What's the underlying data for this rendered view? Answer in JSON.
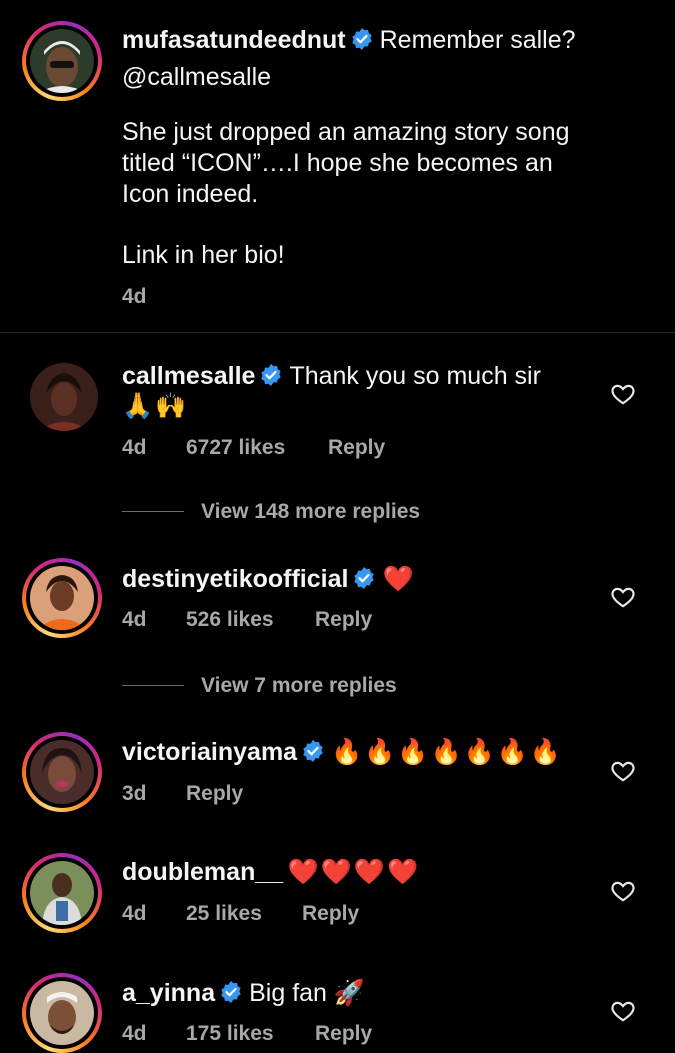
{
  "post": {
    "username": "mufasatundeednut",
    "lines": [
      "Remember salle?",
      "@callmesalle",
      "She just dropped an amazing story song",
      "titled “ICON”….I hope she becomes an",
      "Icon indeed.",
      "Link in her bio!"
    ],
    "time": "4d"
  },
  "comments": [
    {
      "username": "callmesalle",
      "text": "Thank you so much sir",
      "emoji_line": "🙏🙌",
      "time": "4d",
      "likes": "6727 likes",
      "reply": "Reply",
      "view_more": "View 148 more replies"
    },
    {
      "username": "destinyetikoofficial",
      "text": "❤️",
      "time": "4d",
      "likes": "526 likes",
      "reply": "Reply",
      "view_more": "View 7 more replies"
    },
    {
      "username": "victoriainyama",
      "text": "🔥🔥🔥🔥🔥🔥🔥",
      "time": "3d",
      "reply": "Reply"
    },
    {
      "username": "doubleman__",
      "text": "❤️❤️❤️❤️",
      "time": "4d",
      "likes": "25 likes",
      "reply": "Reply"
    },
    {
      "username": "a_yinna",
      "text": "Big fan 🚀",
      "time": "4d",
      "likes": "175 likes",
      "reply": "Reply"
    }
  ],
  "colors": {
    "background": "#000000",
    "verified": "#3897f0",
    "secondary_text": "#a8a8a8",
    "heart_emoji": "#e0245e"
  },
  "icons": [
    "verified-badge-icon",
    "heart-outline-icon"
  ]
}
